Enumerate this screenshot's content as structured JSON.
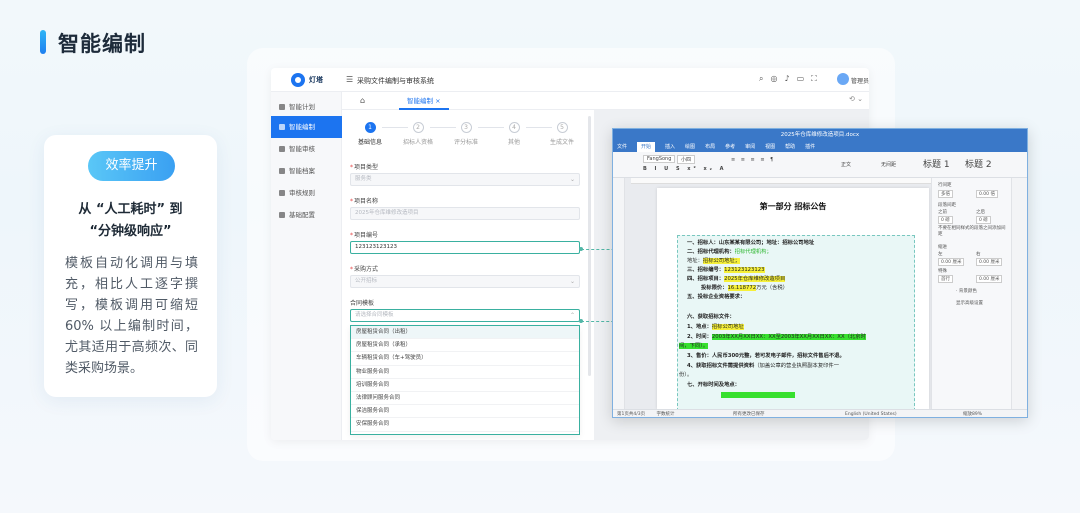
{
  "page": {
    "title": "智能编制"
  },
  "card": {
    "badge": "效率提升",
    "headline_line1": "从 “人工耗时” 到",
    "headline_line2": "“分钟级响应”",
    "body": "模板自动化调用与填充，相比人工逐字撰写，模板调用可缩短60% 以上编制时间，尤其适用于高频次、同类采购场景。"
  },
  "app": {
    "logo_text": "灯塔",
    "system_title": "采购文件编制与审核系统",
    "user": "管理员",
    "sidebar": [
      {
        "label": "智能计划",
        "active": false
      },
      {
        "label": "智能编制",
        "active": true
      },
      {
        "label": "智能审核",
        "active": false
      },
      {
        "label": "智能档案",
        "active": false
      },
      {
        "label": "审核规则",
        "active": false
      },
      {
        "label": "基础配置",
        "active": false
      }
    ],
    "tab": "智能编制 ×",
    "steps": [
      "基础信息",
      "招标人资格",
      "评分标准",
      "其他",
      "生成文件"
    ],
    "step_numbers": [
      "1",
      "2",
      "3",
      "4",
      "5"
    ],
    "form": {
      "project_type_label": "项目类型",
      "project_type_value": "服务类",
      "project_name_label": "项目名称",
      "project_name_value": "2025年仓库维修改造项目",
      "project_no_label": "项目编号",
      "project_no_value": "123123123123",
      "method_label": "采购方式",
      "method_value": "公开招标",
      "contract_label": "合同模板",
      "contract_placeholder": "请选择合同模板"
    },
    "contract_options": [
      "房屋租赁合同（出租）",
      "房屋租赁合同（承租）",
      "车辆租赁合同（车+驾驶员）",
      "物业服务合同",
      "培训服务合同",
      "法律顾问服务合同",
      "保洁服务合同",
      "安保服务合同"
    ]
  },
  "word": {
    "title": "2025年仓库维修改造项目.docx",
    "menu": [
      "文件",
      "开始",
      "插入",
      "绘图",
      "布局",
      "参考",
      "审阅",
      "视图",
      "帮助",
      "插件"
    ],
    "style_normal": "正文",
    "style_nospace": "无间距",
    "style_h1": "标题 1",
    "style_h2": "标题 2",
    "font_name": "FangSong",
    "font_size": "小四",
    "doc_heading": "第一部分   招标公告",
    "lines": {
      "l1": "一、招标人：山东某某有限公司；地址：招标公司地址",
      "l2a": "二、招标代理机构：",
      "l2b": "招标代理机构；",
      "l3a": "地址：",
      "l3b": "招标公司地址；",
      "l4a": "三、招标编号：",
      "l4b": "123123123123",
      "l5a": "四、招标项目：",
      "l5b": "2025年仓库维修改造项目",
      "l6a": "投标限价：",
      "l6b": "16.118772",
      "l6c": "万元（含税）",
      "l7": "五、投标企业资格要求：",
      "l8": "六、获取招标文件：",
      "l9a": "1、地点：",
      "l9b": "招标公司地址",
      "l10a": "2、时间：",
      "l10b": "2003年XX月XX日XX：XX至2003年XX月XX日XX：XX（北京时",
      "l11": "间，下同）。",
      "l12": "3、售价：人民币300元整，若可发电子邮件，招标文件售后不退。",
      "l13a": "4、获取招标文件需提供资料",
      "l13b": "（加盖公章的营业执照副本复印件一",
      "l14": "份）。",
      "l15": "七、开标时间及地点："
    },
    "side": {
      "line_spacing": "行间距",
      "line_value": "0.00 倍",
      "multiple": "多倍",
      "para_spacing": "段落间距",
      "before": "之前",
      "after": "之后",
      "pt": "0 磅",
      "check": "不要在相同样式的段落之间添加间距",
      "indent": "缩进",
      "left": "左",
      "right": "右",
      "indent_value": "0.00 厘米",
      "special": "特殊",
      "first_line": "首行",
      "border_label": "· 背景颜色",
      "advanced": "显示高级设置"
    },
    "status_left": "第1页共4/3页",
    "status_words": "字数统计",
    "status_mid": "所有更改已保存",
    "status_lang": "English (United States)",
    "status_zoom": "缩放89%"
  }
}
